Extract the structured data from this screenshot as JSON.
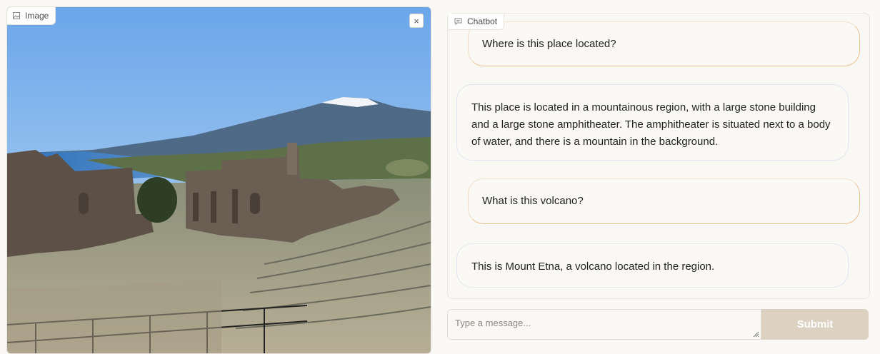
{
  "image_panel": {
    "label": "Image",
    "close_symbol": "×"
  },
  "chatbot": {
    "label": "Chatbot",
    "messages": [
      {
        "role": "user",
        "text": "Where is this place located?"
      },
      {
        "role": "bot",
        "text": "This place is located in a mountainous region, with a large stone building and a large stone amphitheater. The amphitheater is situated next to a body of water, and there is a mountain in the background."
      },
      {
        "role": "user",
        "text": "What is this volcano?"
      },
      {
        "role": "bot",
        "text": "This is Mount Etna, a volcano located in the region."
      }
    ]
  },
  "input": {
    "placeholder": "Type a message..."
  },
  "submit": {
    "label": "Submit"
  },
  "colors": {
    "accent_border": "#ecc28f",
    "submit_bg": "#ddd1c2",
    "bot_border": "#e0e6f0"
  }
}
